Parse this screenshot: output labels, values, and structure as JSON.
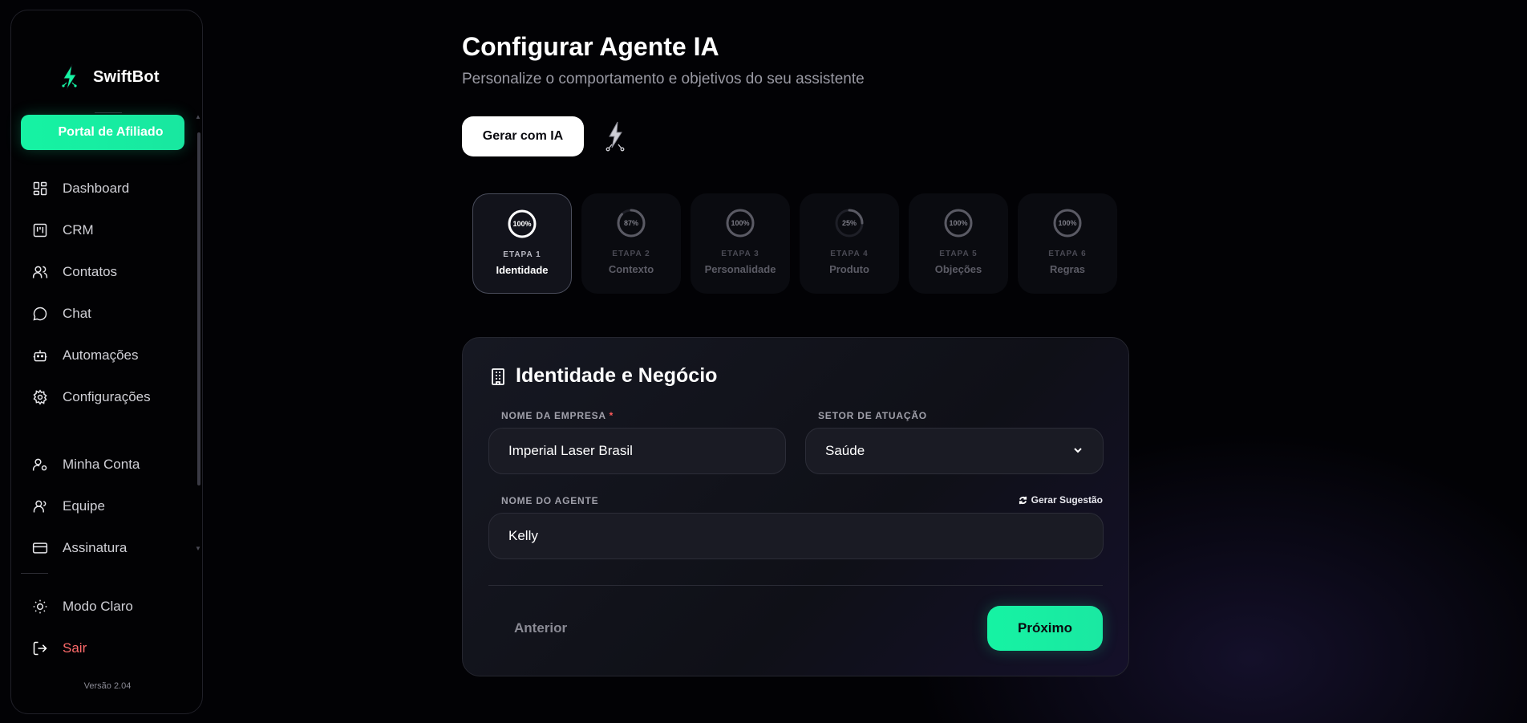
{
  "sidebar": {
    "brand": "SwiftBot",
    "affiliate_button": "Portal de Afiliado",
    "items": [
      {
        "label": "Dashboard",
        "icon": "dashboard-icon"
      },
      {
        "label": "CRM",
        "icon": "kanban-icon"
      },
      {
        "label": "Contatos",
        "icon": "users-icon"
      },
      {
        "label": "Chat",
        "icon": "chat-icon"
      },
      {
        "label": "Automações",
        "icon": "bot-icon"
      },
      {
        "label": "Configurações",
        "icon": "gear-icon"
      }
    ],
    "account_items": [
      {
        "label": "Minha Conta",
        "icon": "user-cog-icon"
      },
      {
        "label": "Equipe",
        "icon": "team-icon"
      },
      {
        "label": "Assinatura",
        "icon": "credit-card-icon"
      }
    ],
    "footer_items": [
      {
        "label": "Modo Claro",
        "icon": "sun-icon"
      },
      {
        "label": "Sair",
        "icon": "logout-icon"
      }
    ],
    "version": "Versão 2.04"
  },
  "page": {
    "title": "Configurar Agente IA",
    "subtitle": "Personalize o comportamento e objetivos do seu assistente",
    "generate_button": "Gerar com IA"
  },
  "steps": [
    {
      "progress": "100%",
      "step_label": "ETAPA 1",
      "name": "Identidade",
      "active": true,
      "fraction": 1.0
    },
    {
      "progress": "87%",
      "step_label": "ETAPA 2",
      "name": "Contexto",
      "active": false,
      "fraction": 0.87
    },
    {
      "progress": "100%",
      "step_label": "ETAPA 3",
      "name": "Personalidade",
      "active": false,
      "fraction": 1.0
    },
    {
      "progress": "25%",
      "step_label": "ETAPA 4",
      "name": "Produto",
      "active": false,
      "fraction": 0.25
    },
    {
      "progress": "100%",
      "step_label": "ETAPA 5",
      "name": "Objeções",
      "active": false,
      "fraction": 1.0
    },
    {
      "progress": "100%",
      "step_label": "ETAPA 6",
      "name": "Regras",
      "active": false,
      "fraction": 1.0
    }
  ],
  "form": {
    "title": "Identidade e Negócio",
    "company_label": "NOME DA EMPRESA",
    "required_mark": "*",
    "company_value": "Imperial Laser Brasil",
    "sector_label": "SETOR DE ATUAÇÃO",
    "sector_value": "Saúde",
    "agent_label": "NOME DO AGENTE",
    "suggest_label": "Gerar Sugestão",
    "agent_value": "Kelly",
    "prev_button": "Anterior",
    "next_button": "Próximo"
  },
  "colors": {
    "accent": "#16f3a3",
    "background": "#020205",
    "danger": "#ff6b6b"
  }
}
